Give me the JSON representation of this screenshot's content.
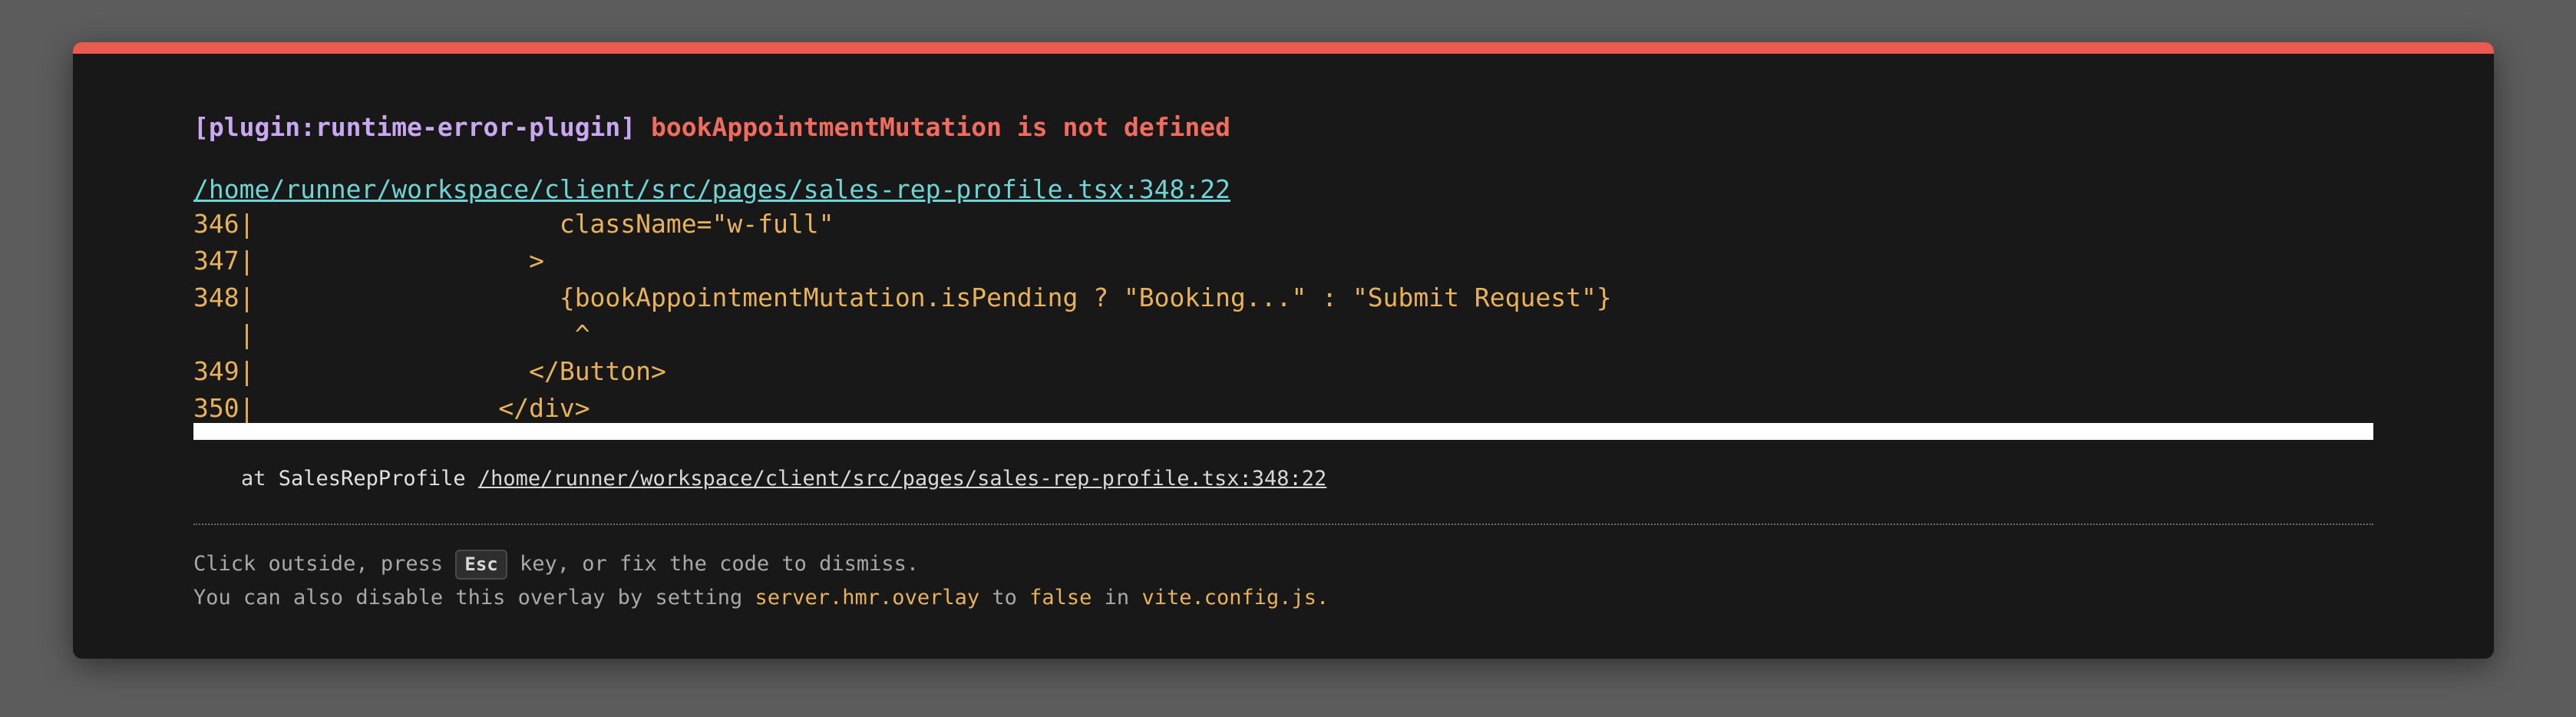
{
  "error": {
    "plugin": "[plugin:runtime-error-plugin]",
    "message": "bookAppointmentMutation is not defined",
    "file": "/home/runner/workspace/client/src/pages/sales-rep-profile.tsx:348:22"
  },
  "frame": {
    "lines": [
      "346|                    className=\"w-full\"",
      "347|                  >",
      "348|                    {bookAppointmentMutation.isPending ? \"Booking...\" : \"Submit Request\"}",
      "   |                     ^",
      "349|                  </Button>",
      "350|                </div>"
    ]
  },
  "stack": {
    "prefix": "at",
    "function": "SalesRepProfile",
    "file": "/home/runner/workspace/client/src/pages/sales-rep-profile.tsx:348:22"
  },
  "tips": {
    "line1_before": "Click outside, press ",
    "key": "Esc",
    "line1_after": " key, or fix the code to dismiss.",
    "line2_before": "You can also disable this overlay by setting ",
    "setting": "server.hmr.overlay",
    "line2_mid": " to ",
    "value": "false",
    "line2_in": " in ",
    "config_file": "vite.config.js",
    "line2_end": "."
  },
  "colors": {
    "accent_bar": "#ea5a4f",
    "plugin": "#c8a8f0",
    "message": "#f26b5f",
    "link": "#6fd4d4",
    "code": "#e8b25a",
    "background": "#181818"
  }
}
